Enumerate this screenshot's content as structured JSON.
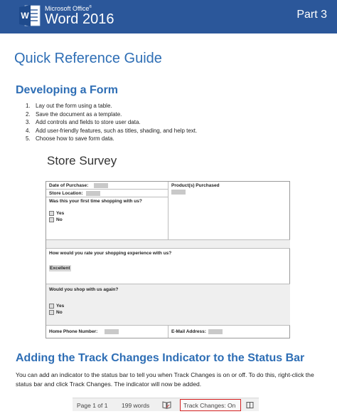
{
  "header": {
    "brand_top": "Microsoft Office",
    "brand_main": "Word 2016",
    "part": "Part 3",
    "logo_letter": "W"
  },
  "title": "Quick Reference Guide",
  "section1": {
    "heading": "Developing a Form",
    "steps": [
      {
        "num": "1.",
        "text": "Lay out the form using a table."
      },
      {
        "num": "2.",
        "text": "Save the document as a template."
      },
      {
        "num": "3.",
        "text": "Add controls and fields to store user data."
      },
      {
        "num": "4.",
        "text": "Add user-friendly features, such as titles, shading, and help text."
      },
      {
        "num": "5.",
        "text": "Choose how to save form data."
      }
    ]
  },
  "form": {
    "title": "Store Survey",
    "date_label": "Date of Purchase:",
    "store_label": "Store Location:",
    "first_time_label": "Was this your first time shopping with us?",
    "yes": "Yes",
    "no": "No",
    "products_label": "Product(s) Purchased",
    "rate_label": "How would you rate your shopping experience with us?",
    "rate_value": "Excellent",
    "again_label": "Would you shop with us again?",
    "phone_label": "Home Phone Number:",
    "email_label": "E-Mail Address:"
  },
  "section2": {
    "heading": "Adding the Track Changes Indicator to the Status Bar",
    "body": "You can add an indicator to the status bar to tell you when Track Changes is on or off. To do this, right-click the status bar and click Track Changes. The indicator will now be added."
  },
  "status_bar": {
    "page": "Page 1 of 1",
    "words": "199 words",
    "track": "Track Changes: On"
  },
  "colors": {
    "banner": "#2b579a",
    "heading": "#2e6eb5",
    "highlight_border": "#d42020"
  }
}
